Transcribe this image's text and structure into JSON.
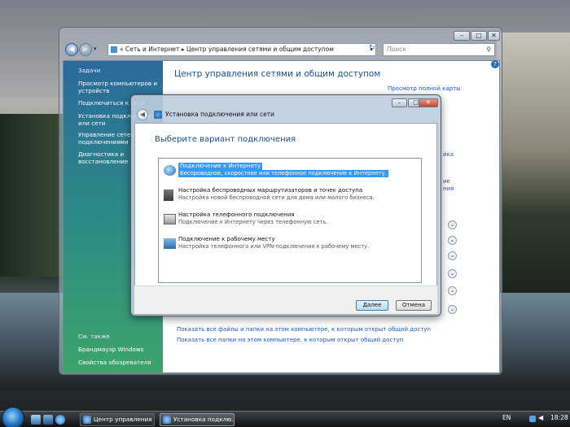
{
  "main_window": {
    "address": {
      "crumbs_prefix": "«",
      "crumb1": "Сеть и Интернет",
      "sep": "▸",
      "crumb2": "Центр управления сетями и общим доступом",
      "search_placeholder": "Поиск"
    },
    "controls": {
      "minimize": "–",
      "maximize": "□",
      "close": "✕"
    },
    "help": "?",
    "sidebar": {
      "tasks_header": "Задачи",
      "items": [
        "Просмотр компьютеров и устройств",
        "Подключиться к сети",
        "Установка подключения или сети",
        "Управление сетевыми подключениями",
        "Диагностика и восстановление"
      ],
      "see_also_header": "См. также",
      "see_also": [
        "Брандмауэр Windows",
        "Свойства обозревателя"
      ]
    },
    "content": {
      "title": "Центр управления сетями и общим доступом",
      "full_map": "Просмотр полной карты",
      "partial1": "йка",
      "partial2": "ие",
      "partial3": "ния",
      "links": [
        "Показать все файлы и папки на этом компьютере, к которым открыт общий доступ",
        "Показать все папки на этом компьютере, к которым открыт общий доступ"
      ]
    }
  },
  "dialog": {
    "title": "Установка подключения или сети",
    "heading": "Выберите вариант подключения",
    "options": [
      {
        "title": "Подключение к Интернету",
        "desc": "Беспроводное, скоростное или телефонное подключение к Интернету.",
        "icon": "globe-icon"
      },
      {
        "title": "Настройка беспроводных маршрутизаторов и точек доступа",
        "desc": "Настройка новой беспроводной сети для дома или малого бизнеса.",
        "icon": "router-icon"
      },
      {
        "title": "Настройка телефонного подключения",
        "desc": "Подключение к Интернету через телефонную сеть.",
        "icon": "phone-icon"
      },
      {
        "title": "Подключение к рабочему месту",
        "desc": "Настройка телефонного или VPN-подключения к рабочему месту.",
        "icon": "workplace-icon"
      }
    ],
    "next": "Далее",
    "cancel": "Отмена"
  },
  "taskbar": {
    "tasks": [
      "Центр управления ...",
      "Установка подклю..."
    ],
    "lang": "EN",
    "time": "18:28"
  }
}
